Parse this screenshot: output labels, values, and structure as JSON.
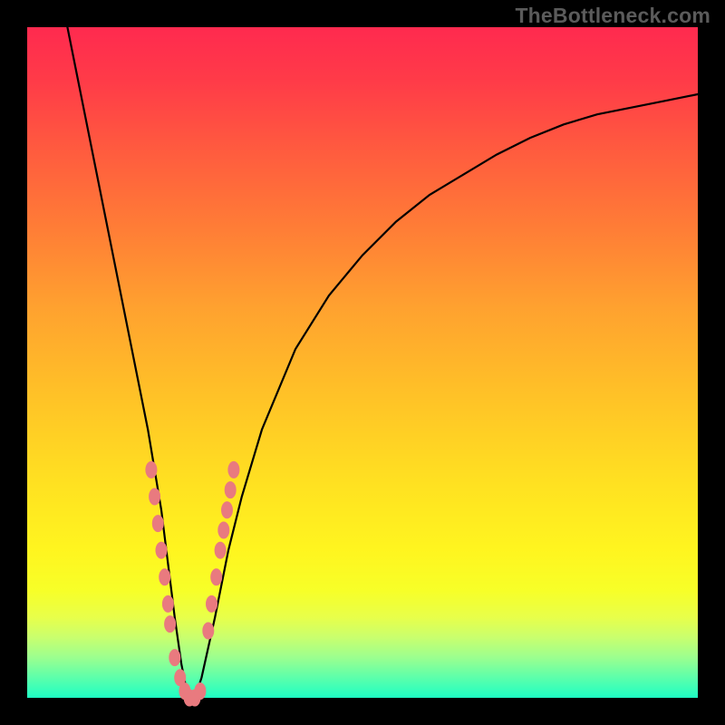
{
  "watermark": {
    "text": "TheBottleneck.com"
  },
  "colors": {
    "frame_bg_top": "#ff2a4f",
    "frame_bg_bottom": "#1effc4",
    "page_bg": "#000000",
    "curve": "#000000",
    "marker": "#e97a7f",
    "watermark": "#5b5b5b"
  },
  "chart_data": {
    "type": "line",
    "title": "",
    "xlabel": "",
    "ylabel": "",
    "x_range": [
      0,
      100
    ],
    "y_range": [
      0,
      100
    ],
    "grid": false,
    "legend": false,
    "series": [
      {
        "name": "bottleneck-curve",
        "x": [
          6,
          8,
          10,
          12,
          14,
          16,
          18,
          20,
          21,
          22,
          23,
          24,
          25,
          26,
          28,
          30,
          32,
          35,
          40,
          45,
          50,
          55,
          60,
          65,
          70,
          75,
          80,
          85,
          90,
          95,
          100
        ],
        "y": [
          100,
          90,
          80,
          70,
          60,
          50,
          40,
          28,
          20,
          12,
          5,
          0,
          0,
          3,
          12,
          22,
          30,
          40,
          52,
          60,
          66,
          71,
          75,
          78,
          81,
          83.5,
          85.5,
          87,
          88,
          89,
          90
        ]
      }
    ],
    "markers": {
      "name": "highlight-points-lower-v",
      "x": [
        18.5,
        19.0,
        19.5,
        20.0,
        20.5,
        21.0,
        21.3,
        22.0,
        22.8,
        23.5,
        24.2,
        25.0,
        25.8,
        27.0,
        27.5,
        28.2,
        28.8,
        29.3,
        29.8,
        30.3,
        30.8
      ],
      "y": [
        34,
        30,
        26,
        22,
        18,
        14,
        11,
        6,
        3,
        1,
        0,
        0,
        1,
        10,
        14,
        18,
        22,
        25,
        28,
        31,
        34
      ]
    },
    "notes": "Values are approximate — read off pixel positions; axes are unlabeled in the source image. x and y normalised to 0–100 of the inner plot area; y=0 is bottom (green), y=100 is top (red)."
  }
}
